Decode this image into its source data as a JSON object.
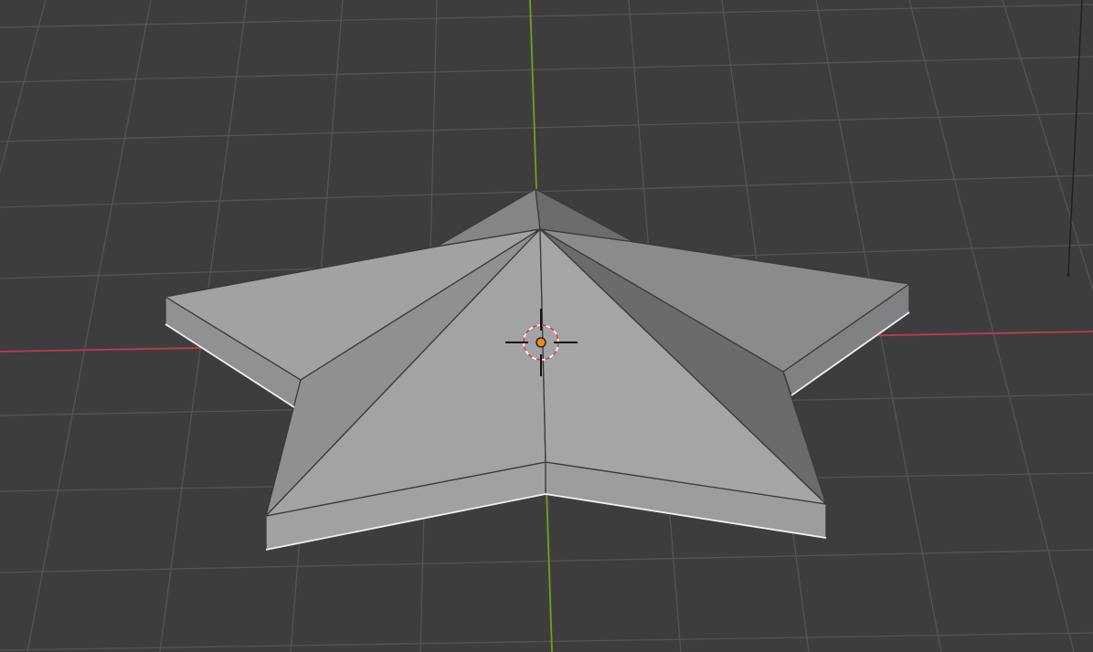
{
  "viewport": {
    "mode": "3D Viewport",
    "background_color": "#3d3d3d",
    "grid_color": "#545454",
    "x_axis_color": "#c0394b",
    "y_axis_color": "#6ea022",
    "object": {
      "shape": "star",
      "points": 5,
      "extruded": true,
      "selected": false,
      "face_colors": {
        "light": "#a3a5a7",
        "mid": "#8c8e90",
        "dark": "#6b6c6e",
        "side": "#9b9d9f"
      }
    },
    "origin_color": "#f08a1a",
    "cursor_ring_colors": [
      "#d83a3a",
      "#ffffff"
    ]
  }
}
